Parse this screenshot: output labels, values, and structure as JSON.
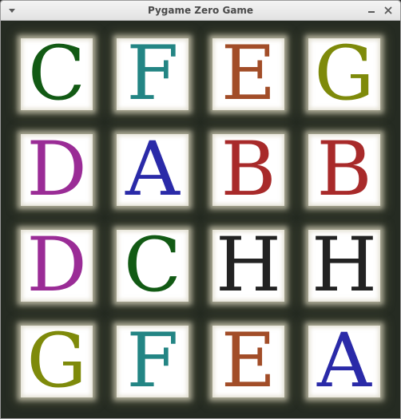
{
  "window": {
    "title": "Pygame Zero Game"
  },
  "icons": {
    "menu": "chevron-down-icon",
    "minimize": "minimize-icon",
    "close": "close-icon"
  },
  "colors": {
    "background": "#252b22",
    "tile": "#ffffff",
    "dark_green": "#125a14",
    "teal": "#238584",
    "brown": "#a24d28",
    "olive": "#7e8a0a",
    "purple": "#9a2c96",
    "blue": "#2a2aa8",
    "red": "#a82a2a",
    "black": "#222222"
  },
  "board": {
    "rows": [
      [
        {
          "letter": "C",
          "color": "#125a14"
        },
        {
          "letter": "F",
          "color": "#238584"
        },
        {
          "letter": "E",
          "color": "#a24d28"
        },
        {
          "letter": "G",
          "color": "#7e8a0a"
        }
      ],
      [
        {
          "letter": "D",
          "color": "#9a2c96"
        },
        {
          "letter": "A",
          "color": "#2a2aa8"
        },
        {
          "letter": "B",
          "color": "#a82a2a"
        },
        {
          "letter": "B",
          "color": "#a82a2a"
        }
      ],
      [
        {
          "letter": "D",
          "color": "#9a2c96"
        },
        {
          "letter": "C",
          "color": "#125a14"
        },
        {
          "letter": "H",
          "color": "#222222"
        },
        {
          "letter": "H",
          "color": "#222222"
        }
      ],
      [
        {
          "letter": "G",
          "color": "#7e8a0a"
        },
        {
          "letter": "F",
          "color": "#238584"
        },
        {
          "letter": "E",
          "color": "#a24d28"
        },
        {
          "letter": "A",
          "color": "#2a2aa8"
        }
      ]
    ]
  }
}
